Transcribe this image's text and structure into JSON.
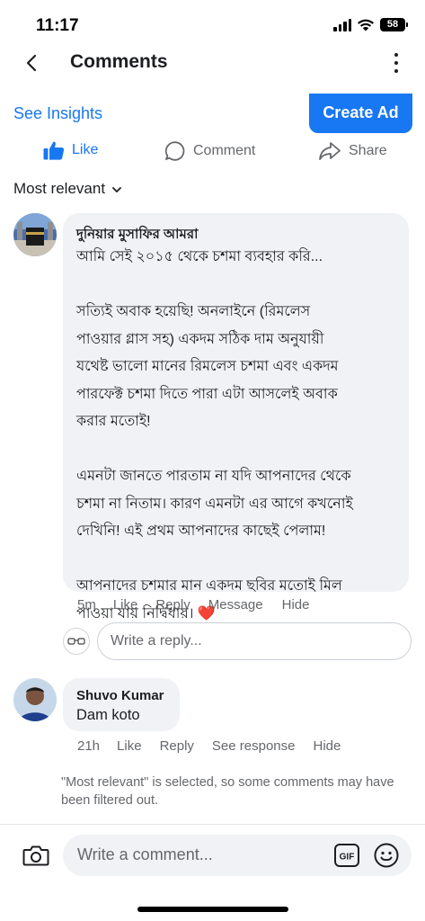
{
  "status_bar": {
    "time": "11:17",
    "battery": "58"
  },
  "header": {
    "title": "Comments"
  },
  "insights": {
    "see_insights": "See Insights",
    "create_ad": "Create Ad"
  },
  "actions": {
    "like": "Like",
    "comment": "Comment",
    "share": "Share"
  },
  "filter": {
    "label": "Most relevant"
  },
  "comments": [
    {
      "author": "দুনিয়ার মুসাফির আমরা",
      "text": "আমি সেই ২০১৫ থেকে চশমা ব্যবহার করি...\n\nসত্যিই অবাক হয়েছি! অনলাইনে (রিমলেস\nপাওয়ার গ্লাস সহ) একদম সঠিক দাম অনুযায়ী\nযথেষ্ট ভালো মানের রিমলেস চশমা এবং একদম\nপারফেক্ট চশমা দিতে পারা এটা আসলেই অবাক\nকরার মতোই!\n\nএমনটা জানতে পারতাম না যদি আপনাদের থেকে\nচশমা না নিতাম। কারণ এমনটা এর আগে কখনোই\nদেখিনি! এই প্রথম আপনাদের কাছেই পেলাম!\n\nআপনাদের চশমার মান একদম ছবির মতোই মিল\nপাওয়া যায় নির্দ্বিধায়। ❤️",
      "time": "5m",
      "like": "Like",
      "reply": "Reply",
      "message": "Message",
      "hide": "Hide"
    },
    {
      "author": "Shuvo Kumar",
      "text": "Dam koto",
      "time": "21h",
      "like": "Like",
      "reply": "Reply",
      "see_response": "See response",
      "hide": "Hide"
    }
  ],
  "reply_box": {
    "placeholder": "Write a reply..."
  },
  "filter_note": "\"Most relevant\" is selected, so some comments may have been filtered out.",
  "composer": {
    "placeholder": "Write a comment...",
    "gif": "GIF"
  },
  "colors": {
    "accent": "#1877f2",
    "bubble": "#f0f2f5",
    "muted": "#65676b",
    "heart": "#e0245e"
  },
  "icons": [
    "back-icon",
    "more-icon",
    "like-thumb-icon",
    "comment-icon",
    "share-icon",
    "chevron-down-icon",
    "glasses-icon",
    "camera-icon",
    "gif-icon",
    "emoji-icon"
  ]
}
